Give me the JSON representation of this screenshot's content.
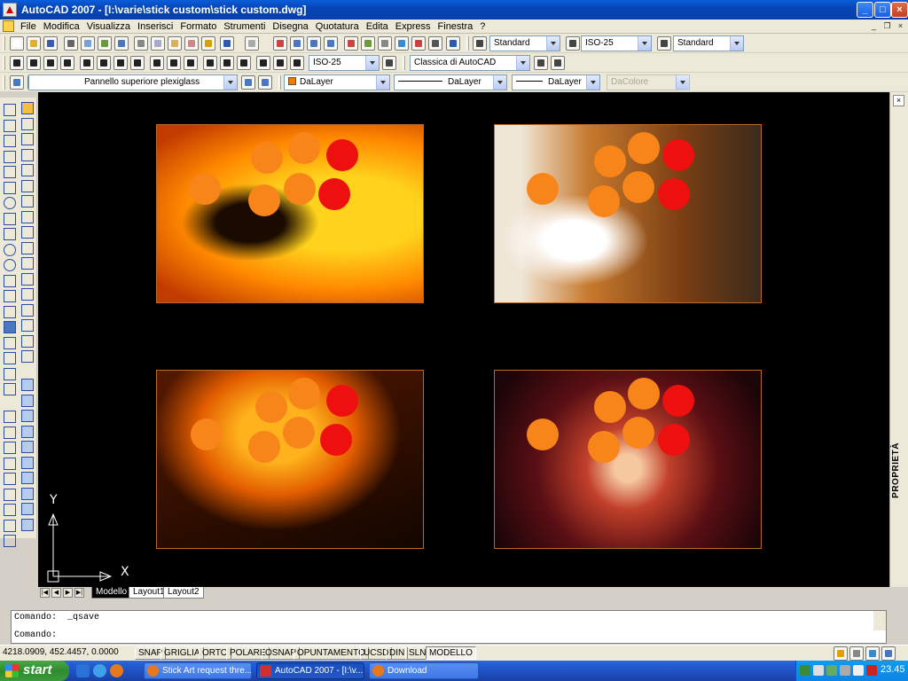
{
  "window": {
    "title": "AutoCAD 2007 - [I:\\varie\\stick custom\\stick custom.dwg]",
    "minimize": "_",
    "maximize": "□",
    "close": "×"
  },
  "menu": {
    "items": [
      "File",
      "Modifica",
      "Visualizza",
      "Inserisci",
      "Formato",
      "Strumenti",
      "Disegna",
      "Quotatura",
      "Edita",
      "Express",
      "Finestra",
      "?"
    ]
  },
  "toolbar": {
    "text_style": "Standard",
    "dim_style": "ISO-25",
    "table_style": "Standard",
    "dim_style_2": "ISO-25",
    "workspace": "Classica di AutoCAD",
    "layer": "Pannello superiore plexiglass",
    "color": "DaLayer",
    "linetype": "DaLayer",
    "lineweight": "DaLayer",
    "plot_style": "DaColore"
  },
  "canvas": {
    "panels": [
      {
        "name": "flames-swordsman",
        "palette": [
          "#ffd21c",
          "#ff8a00",
          "#c23b00",
          "#1a0a00"
        ]
      },
      {
        "name": "tiger",
        "palette": [
          "#f0e6d6",
          "#c77a2e",
          "#7a3f14",
          "#3b2a1c"
        ]
      },
      {
        "name": "fire-scene",
        "palette": [
          "#ffb21c",
          "#e35d00",
          "#551800",
          "#120600"
        ]
      },
      {
        "name": "abstract-swirl",
        "palette": [
          "#f6c8a0",
          "#c2402a",
          "#5a0f14",
          "#1c0508"
        ]
      }
    ],
    "ucs_y": "Y",
    "ucs_x": "X"
  },
  "properties_label": "PROPRIETÀ",
  "tabs": [
    "Modello",
    "Layout1",
    "Layout2"
  ],
  "command": {
    "history": "Comando:  _qsave",
    "prompt": "Comando:"
  },
  "status": {
    "coordinates": "4218.0909, 452.4457, 0.0000",
    "buttons": [
      "SNAP",
      "GRIGLIA",
      "ORTO",
      "POLARE",
      "OSNAP",
      "OPUNTAMENTO",
      "UCSD",
      "DIN",
      "SLN",
      "MODELLO"
    ]
  },
  "taskbar": {
    "start": "start",
    "tasks": [
      "Stick Art request thre...",
      "AutoCAD 2007 - [I:\\v...",
      "Download"
    ],
    "clock": "23.45"
  }
}
